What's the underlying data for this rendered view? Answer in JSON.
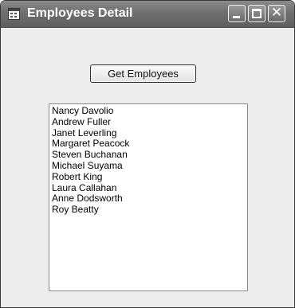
{
  "window": {
    "title": "Employees Detail"
  },
  "caption_buttons": {
    "minimize_icon": "minimize-icon",
    "maximize_icon": "maximize-icon",
    "close_icon": "close-icon",
    "close_glyph": "✕"
  },
  "toolbar": {
    "get_employees_label": "Get Employees"
  },
  "employees": [
    "Nancy Davolio",
    "Andrew Fuller",
    "Janet Leverling",
    "Margaret Peacock",
    "Steven Buchanan",
    "Michael Suyama",
    "Robert King",
    "Laura Callahan",
    "Anne Dodsworth",
    "Roy Beatty"
  ]
}
